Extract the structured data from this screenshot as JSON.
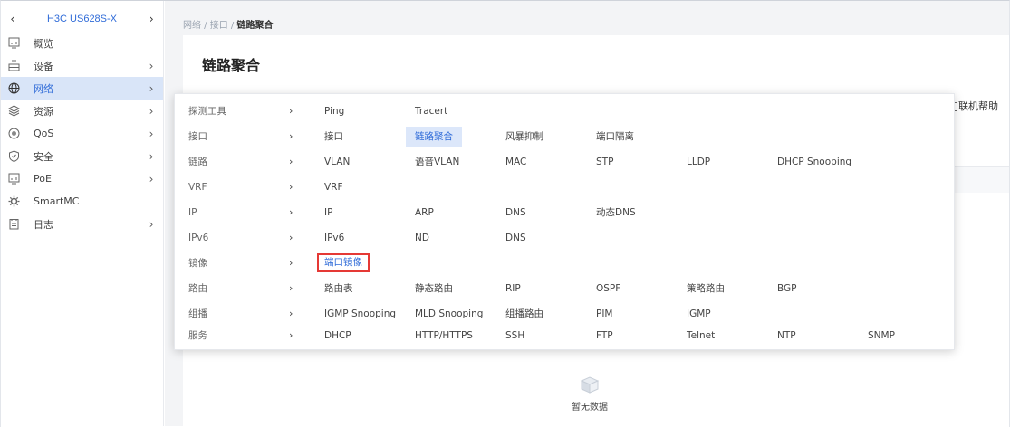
{
  "sidebar": {
    "device_name": "H3C US628S-X",
    "prev_arrow": "‹",
    "next_arrow": "›",
    "items": [
      {
        "label": "概览",
        "chevron": "",
        "icon": "monitor-chart-icon",
        "active": false
      },
      {
        "label": "设备",
        "chevron": "›",
        "icon": "device-icon",
        "active": false
      },
      {
        "label": "网络",
        "chevron": "›",
        "icon": "globe-icon",
        "active": true
      },
      {
        "label": "资源",
        "chevron": "›",
        "icon": "layers-icon",
        "active": false
      },
      {
        "label": "QoS",
        "chevron": "›",
        "icon": "qos-icon",
        "active": false
      },
      {
        "label": "安全",
        "chevron": "›",
        "icon": "shield-icon",
        "active": false
      },
      {
        "label": "PoE",
        "chevron": "›",
        "icon": "poe-icon",
        "active": false
      },
      {
        "label": "SmartMC",
        "chevron": "",
        "icon": "gear-icon",
        "active": false
      },
      {
        "label": "日志",
        "chevron": "›",
        "icon": "log-icon",
        "active": false
      }
    ]
  },
  "breadcrumb": {
    "parts": [
      "网络",
      " / ",
      "接口",
      " / "
    ],
    "current": "链路聚合"
  },
  "page": {
    "title": "链路聚合",
    "help_label": "联机帮助",
    "empty_text": "暂无数据"
  },
  "menu": {
    "arrow": "›",
    "rows": [
      {
        "category": "探测工具",
        "items": [
          "Ping",
          "Tracert"
        ]
      },
      {
        "category": "接口",
        "items": [
          "接口",
          "链路聚合",
          "风暴抑制",
          "端口隔离"
        ]
      },
      {
        "category": "链路",
        "items": [
          "VLAN",
          "语音VLAN",
          "MAC",
          "STP",
          "LLDP",
          "DHCP Snooping"
        ]
      },
      {
        "category": "VRF",
        "items": [
          "VRF"
        ]
      },
      {
        "category": "IP",
        "items": [
          "IP",
          "ARP",
          "DNS",
          "动态DNS"
        ]
      },
      {
        "category": "IPv6",
        "items": [
          "IPv6",
          "ND",
          "DNS"
        ]
      },
      {
        "category": "镜像",
        "items": [
          "端口镜像"
        ]
      },
      {
        "category": "路由",
        "items": [
          "路由表",
          "静态路由",
          "RIP",
          "OSPF",
          "策略路由",
          "BGP"
        ]
      },
      {
        "category": "组播",
        "items": [
          "IGMP Snooping",
          "MLD Snooping",
          "组播路由",
          "PIM",
          "IGMP"
        ]
      },
      {
        "category": "服务",
        "items": [
          "DHCP",
          "HTTP/HTTPS",
          "SSH",
          "FTP",
          "Telnet",
          "NTP",
          "SNMP"
        ]
      }
    ],
    "selected": "链路聚合",
    "highlighted": "端口镜像"
  },
  "colors": {
    "accent": "#2f6bd8",
    "active_bg": "#d9e5f8",
    "highlight_border": "#e53935"
  }
}
